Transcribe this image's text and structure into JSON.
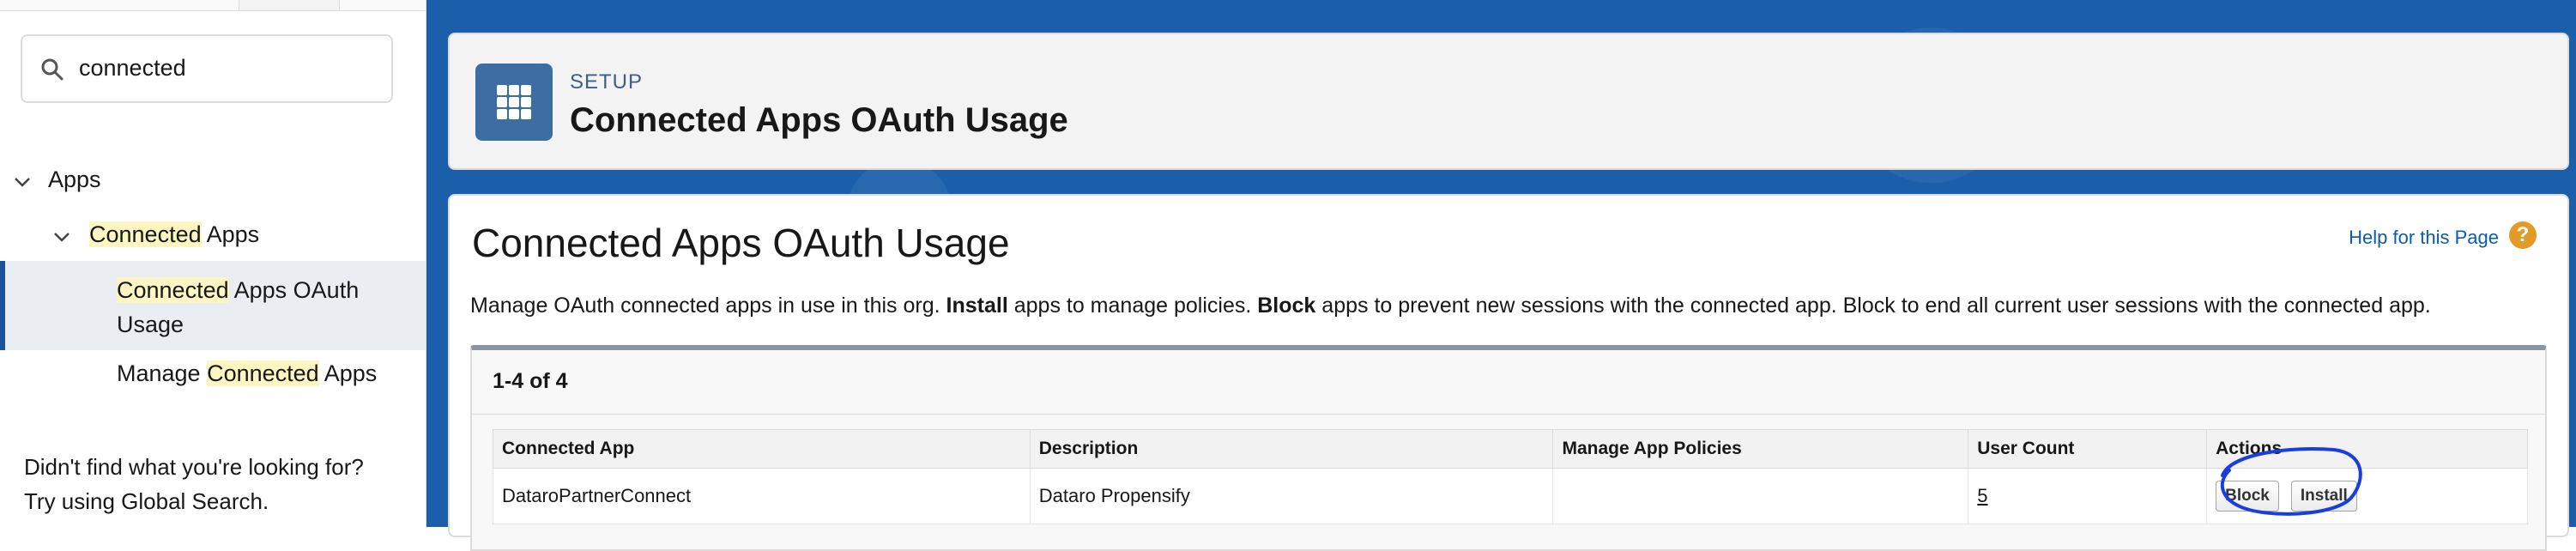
{
  "search": {
    "value": "connected"
  },
  "sidebar": {
    "tree": [
      {
        "pre": "",
        "hl": "",
        "post": "Apps"
      },
      {
        "pre": "",
        "hl": "Connected",
        "post": " Apps"
      }
    ],
    "selected": {
      "hl": "Connected",
      "post_line1": " Apps OAuth",
      "line2": "Usage"
    },
    "manage": {
      "pre": "Manage ",
      "hl": "Connected",
      "post": " Apps"
    },
    "help_line1": "Didn't find what you're looking for?",
    "help_line2": "Try using Global Search."
  },
  "header": {
    "setup_label": "SETUP",
    "title": "Connected Apps OAuth Usage"
  },
  "page": {
    "title": "Connected Apps OAuth Usage",
    "help_link": "Help for this Page",
    "description": {
      "part1": "Manage OAuth connected apps in use in this org. ",
      "bold1": "Install",
      "part2": " apps to manage policies. ",
      "bold2": "Block",
      "part3": " apps to prevent new sessions with the connected app. Block to end all current user sessions with the connected app."
    },
    "results_count": "1-4 of 4"
  },
  "table": {
    "headers": [
      "Connected App",
      "Description",
      "Manage App Policies",
      "User Count",
      "Actions"
    ],
    "rows": [
      {
        "app": "DataroPartnerConnect",
        "description": "Dataro Propensify",
        "policies": "",
        "user_count": "5",
        "actions": [
          "Block",
          "Install"
        ]
      }
    ]
  },
  "colors": {
    "brand_blue": "#1b5faa",
    "selected_border": "#1b5297",
    "highlight": "#fdf6c3",
    "link": "#0b5cab",
    "annotation": "#1a3de0"
  }
}
